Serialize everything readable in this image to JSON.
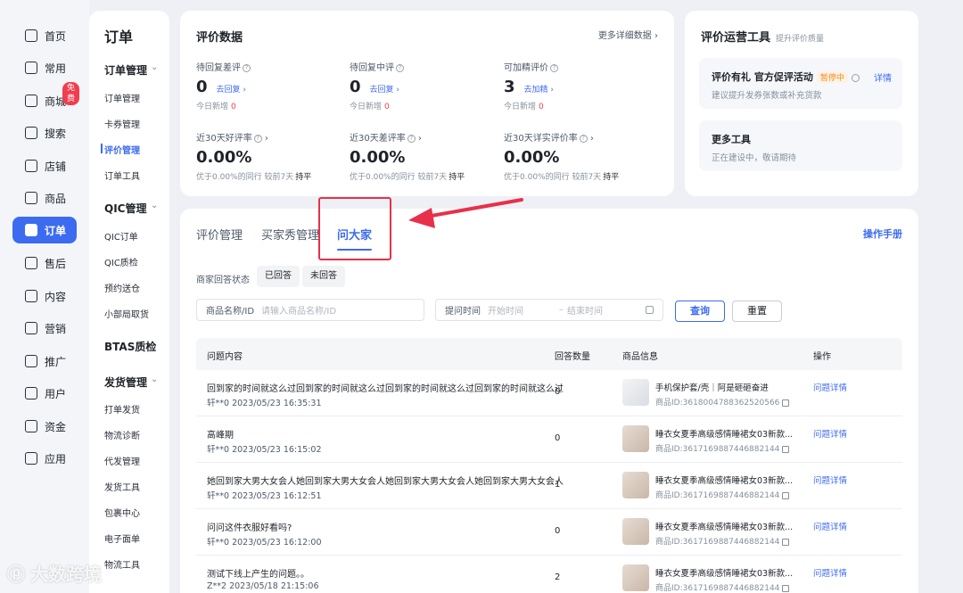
{
  "rail": {
    "items": [
      {
        "label": "首页",
        "icon": "home-icon"
      },
      {
        "label": "常用",
        "icon": "folder-icon"
      },
      {
        "label": "商城",
        "icon": "store-icon",
        "badge": "免费"
      },
      {
        "label": "搜索",
        "icon": "search-icon"
      },
      {
        "label": "店铺",
        "icon": "shop-icon"
      },
      {
        "label": "商品",
        "icon": "goods-icon"
      },
      {
        "label": "订单",
        "icon": "order-icon"
      },
      {
        "label": "售后",
        "icon": "after-sale-icon"
      },
      {
        "label": "内容",
        "icon": "content-icon"
      },
      {
        "label": "营销",
        "icon": "marketing-icon"
      },
      {
        "label": "推广",
        "icon": "promotion-icon"
      },
      {
        "label": "用户",
        "icon": "user-icon"
      },
      {
        "label": "资金",
        "icon": "funds-icon"
      },
      {
        "label": "应用",
        "icon": "apps-icon"
      }
    ]
  },
  "subnav": {
    "title": "订单",
    "groups": [
      {
        "label": "订单管理",
        "items": [
          "订单管理",
          "卡券管理",
          "评价管理",
          "订单工具"
        ]
      },
      {
        "label": "QIC管理",
        "items": [
          "QIC订单",
          "QIC质检",
          "预约送仓",
          "小部局取货"
        ]
      },
      {
        "label": "BTAS质检",
        "items": []
      },
      {
        "label": "发货管理",
        "items": [
          "打单发货",
          "物流诊断",
          "代发管理",
          "发货工具",
          "包裹中心",
          "电子面单",
          "物流工具"
        ]
      }
    ]
  },
  "eval": {
    "title": "评价数据",
    "more": "更多详细数据 ›",
    "metrics": [
      {
        "label": "待回复差评",
        "value": "0",
        "action": "去回复 ›",
        "sub": "今日新增",
        "sub_val": "0"
      },
      {
        "label": "待回复中评",
        "value": "0",
        "action": "去回复 ›",
        "sub": "今日新增",
        "sub_val": "0"
      },
      {
        "label": "可加精评价",
        "value": "3",
        "action": "去加精 ›",
        "sub": "今日新增",
        "sub_val": "0"
      },
      {
        "label": "近30天好评率",
        "value": "0.00%",
        "sub": "优于0.00%的同行  较前7天",
        "sub_val": "持平"
      },
      {
        "label": "近30天差评率",
        "value": "0.00%",
        "sub": "优于0.00%的同行  较前7天",
        "sub_val": "持平"
      },
      {
        "label": "近30天详实评价率",
        "value": "0.00%",
        "sub": "优于0.00%的同行  较前7天",
        "sub_val": "持平"
      }
    ]
  },
  "tools": {
    "title": "评价运营工具",
    "subtitle": "提升评价质量",
    "box1_title": "评价有礼 官方促评活动",
    "box1_status": "暂停中",
    "box1_link": "详情",
    "box1_desc": "建议提升发券张数或补充货款",
    "box2_title": "更多工具",
    "box2_desc": "正在建设中，敬请期待"
  },
  "main": {
    "tabs": [
      "评价管理",
      "买家秀管理",
      "问大家"
    ],
    "manual": "操作手册",
    "status_label": "商家回答状态",
    "chips": [
      "已回答",
      "未回答"
    ],
    "product_label": "商品名称/ID",
    "product_placeholder": "请输入商品名称/ID",
    "time_label": "提问时间",
    "time_start": "开始时间",
    "time_end": "结束时间",
    "query": "查询",
    "reset": "重置",
    "columns": [
      "问题内容",
      "回答数量",
      "商品信息",
      "操作"
    ],
    "rows": [
      {
        "q": "回到家的时间就这么过回到家的时间就这么过回到家的时间就这么过回到家的时间就这么过",
        "meta": "轩**0  2023/05/23 16:35:31",
        "count": "0",
        "pname": "手机保护套/壳｜阿是砸砸奋进",
        "pid": "商品ID:3618004788362520566",
        "op": "问题详情",
        "thumb": "w"
      },
      {
        "q": "高峰期",
        "meta": "轩**0  2023/05/23 16:15:02",
        "count": "0",
        "pname": "睡衣女夏季高级感情睡裙女03新款...",
        "pid": "商品ID:3617169887446882144",
        "op": "问题详情",
        "thumb": ""
      },
      {
        "q": "她回到家大男大女会人她回到家大男大女会人她回到家大男大女会人她回到家大男大女会人",
        "meta": "轩**0  2023/05/23 16:12:51",
        "count": "1",
        "pname": "睡衣女夏季高级感情睡裙女03新款...",
        "pid": "商品ID:3617169887446882144",
        "op": "问题详情",
        "thumb": ""
      },
      {
        "q": "问问这件衣服好看吗?",
        "meta": "轩**0  2023/05/23 16:12:00",
        "count": "0",
        "pname": "睡衣女夏季高级感情睡裙女03新款...",
        "pid": "商品ID:3617169887446882144",
        "op": "问题详情",
        "thumb": ""
      },
      {
        "q": "测试下线上产生的问题。。",
        "meta": "Z**2  2023/05/18 21:15:06",
        "count": "2",
        "pname": "睡衣女夏季高级感情睡裙女03新款...",
        "pid": "商品ID:3617169887446882144",
        "op": "问题详情",
        "thumb": ""
      }
    ]
  },
  "watermark": "大数跨境"
}
